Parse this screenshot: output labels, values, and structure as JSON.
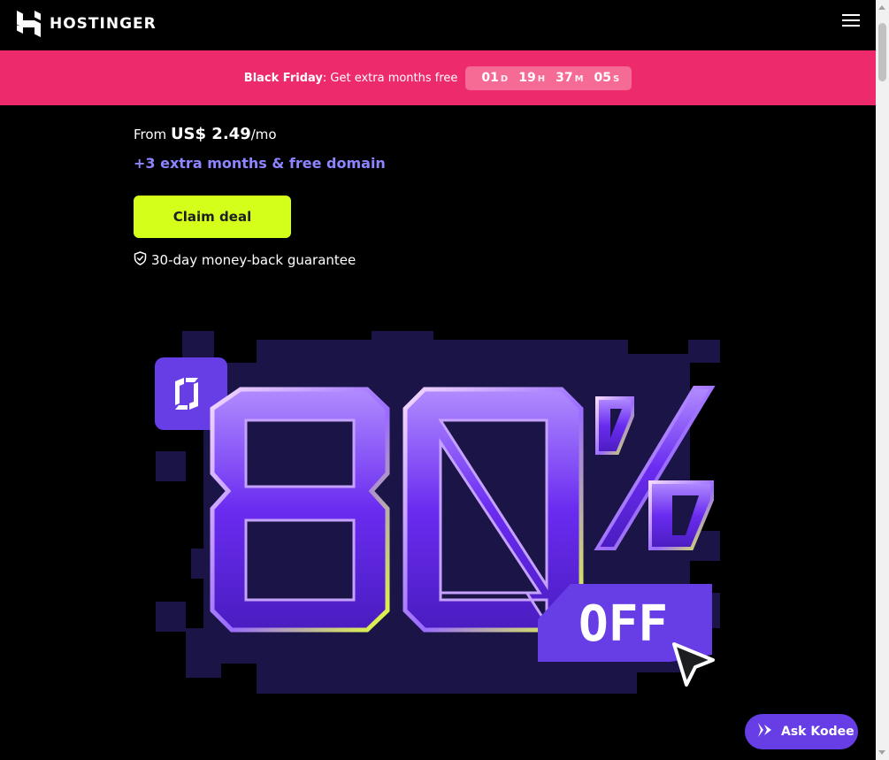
{
  "header": {
    "brand": "HOSTINGER",
    "logo_icon": "hostinger-h-logo",
    "menu_icon": "hamburger-menu-icon"
  },
  "promo": {
    "label_bold": "Black Friday",
    "label_rest": ": Get extra months free",
    "countdown": {
      "days": "01",
      "days_unit": "D",
      "hours": "19",
      "hours_unit": "H",
      "minutes": "37",
      "minutes_unit": "M",
      "seconds": "05",
      "seconds_unit": "S"
    }
  },
  "offer": {
    "price_prefix": "From ",
    "price": "US$ 2.49",
    "price_suffix": "/mo",
    "extra": "+3 extra months & free domain",
    "cta": "Claim deal",
    "guarantee": "30-day money-back guarantee"
  },
  "hero": {
    "percent": "80%",
    "off": "OFF"
  },
  "chat": {
    "label": "Ask Kodee"
  },
  "colors": {
    "promo_bg": "#ed2a6b",
    "cta_bg": "#d4ff1a",
    "accent_purple": "#673de6",
    "extra_text": "#8c85ff"
  }
}
